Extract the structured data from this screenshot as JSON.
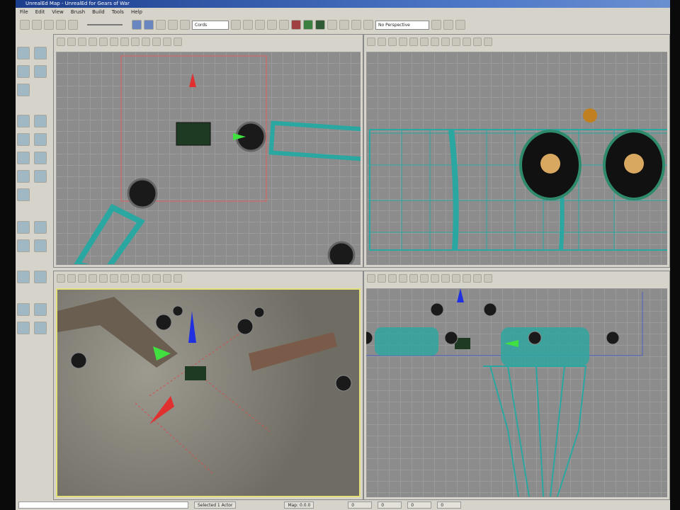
{
  "window": {
    "title": "UnrealEd Map - UnrealEd for Gears of War"
  },
  "menu": [
    "File",
    "Edit",
    "View",
    "Brush",
    "Build",
    "Tools",
    "Help"
  ],
  "toolbar": {
    "grid_combo": "Cords",
    "perspective_combo": "No Perspective"
  },
  "viewports": [
    {
      "name": "top",
      "view": "Top"
    },
    {
      "name": "side",
      "view": "Side"
    },
    {
      "name": "perspective",
      "view": "Perspective"
    },
    {
      "name": "front",
      "view": "Front"
    }
  ],
  "status": {
    "left": "",
    "middle": "Selected 1 Actor",
    "right": "Map: 0.0.0",
    "fields": [
      "0",
      "0",
      "0",
      "0"
    ]
  },
  "colors": {
    "wire": "#2aa7a0",
    "selection": "#e05050",
    "grid": "#8c8c8c"
  }
}
